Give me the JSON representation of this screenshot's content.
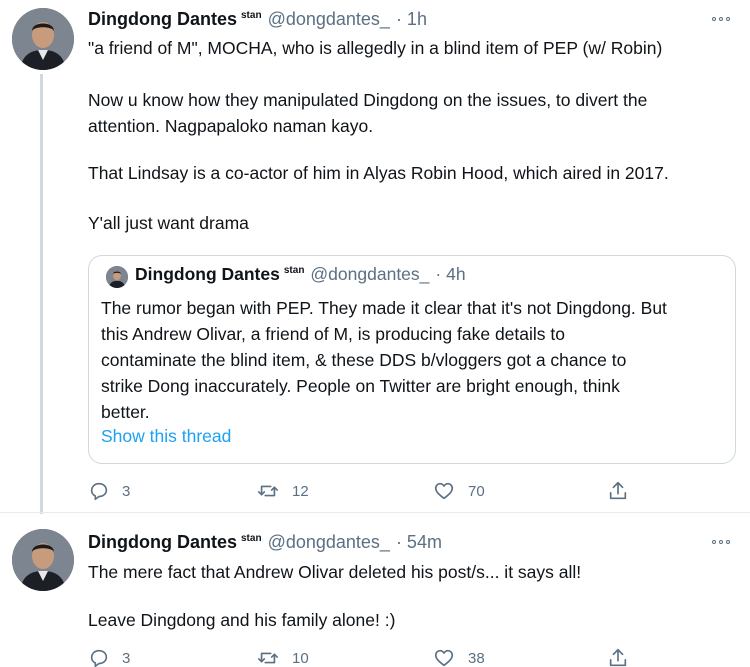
{
  "tweets": [
    {
      "name": "Dingdong Dantes",
      "name_suffix": "stan",
      "handle": "@dongdantes_",
      "time": "· 1h",
      "lines": [
        "\"a friend of M\", MOCHA, who is allegedly in a blind item of PEP (w/ Robin)",
        "Now u know how they manipulated Dingdong on the issues, to divert the",
        "attention. Nagpapaloko naman kayo.",
        "That Lindsay is a co-actor of him in Alyas Robin Hood, which aired in 2017.",
        "Y'all just want drama"
      ],
      "quote": {
        "name": "Dingdong Dantes",
        "name_suffix": "stan",
        "handle": "@dongdantes_",
        "time": "· 4h",
        "lines": [
          "The rumor began with PEP. They made it clear that it's not Dingdong. But",
          "this Andrew Olivar, a friend of M, is producing fake details to",
          "contaminate the blind item, & these DDS b/vloggers got a chance to",
          "strike Dong inaccurately. People on Twitter are bright enough, think",
          "better."
        ],
        "link": "Show this thread"
      },
      "actions": {
        "replies": "3",
        "retweets": "12",
        "likes": "70"
      }
    },
    {
      "name": "Dingdong Dantes",
      "name_suffix": "stan",
      "handle": "@dongdantes_",
      "time": "· 54m",
      "lines": [
        "The mere fact that Andrew Olivar deleted his post/s... it says all!",
        "Leave Dingdong and his family alone! :)"
      ],
      "actions": {
        "replies": "3",
        "retweets": "10",
        "likes": "38"
      }
    }
  ],
  "icons": {
    "reply": "reply-icon",
    "retweet": "retweet-icon",
    "like": "heart-icon",
    "share": "share-icon",
    "more": "more-options-icon"
  },
  "colors": {
    "text": "#0f1419",
    "secondary": "#5b7083",
    "link": "#1da1f2",
    "border": "#cfd9de"
  }
}
